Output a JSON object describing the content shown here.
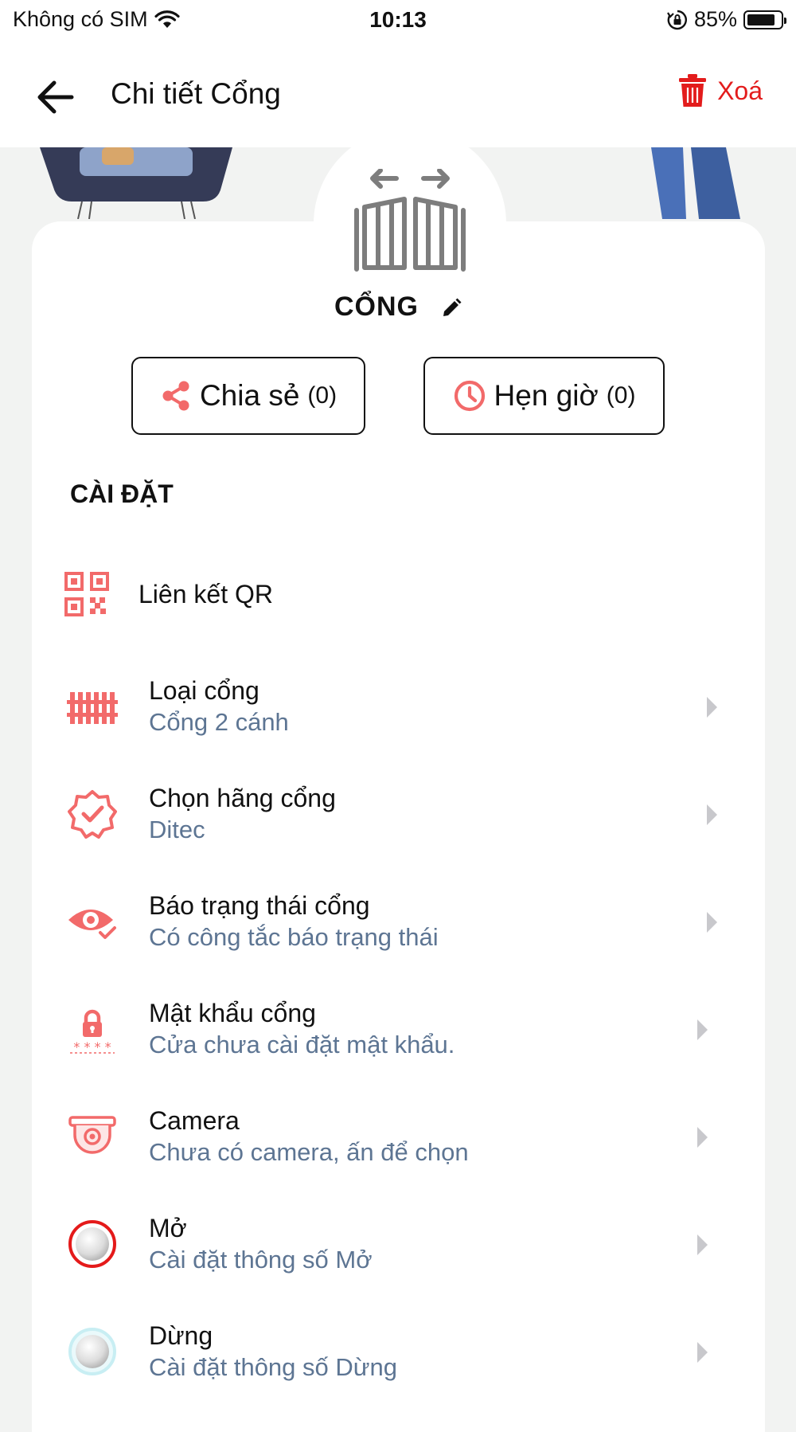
{
  "status_bar": {
    "carrier": "Không có SIM",
    "time": "10:13",
    "battery_percent": "85%",
    "battery_level": 0.85
  },
  "nav": {
    "title": "Chi tiết Cổng",
    "delete_label": "Xoá"
  },
  "device": {
    "name": "CỔNG"
  },
  "actions": {
    "share": {
      "label": "Chia sẻ",
      "count": "(0)"
    },
    "timer": {
      "label": "Hẹn giờ",
      "count": "(0)"
    }
  },
  "settings": {
    "section_title": "CÀI ĐẶT",
    "qr_label": "Liên kết QR",
    "items": [
      {
        "title": "Loại cổng",
        "subtitle": "Cổng 2 cánh",
        "icon": "fence-icon"
      },
      {
        "title": "Chọn hãng cổng",
        "subtitle": "Ditec",
        "icon": "verified-badge-icon"
      },
      {
        "title": "Báo trạng thái cổng",
        "subtitle": "Có công tắc báo trạng thái",
        "icon": "eye-check-icon"
      },
      {
        "title": "Mật khẩu cổng",
        "subtitle": "Cửa chưa cài đặt mật khẩu.",
        "icon": "lock-password-icon"
      },
      {
        "title": "Camera",
        "subtitle": "Chưa có camera, ấn để chọn",
        "icon": "camera-icon"
      },
      {
        "title": "Mở",
        "subtitle": "Cài đặt thông số Mở",
        "icon": "open-button-icon"
      },
      {
        "title": "Dừng",
        "subtitle": "Cài đặt thông số Dừng",
        "icon": "stop-button-icon"
      }
    ]
  },
  "colors": {
    "accent": "#f26a6a",
    "danger": "#e31c1c",
    "subtitle": "#5d7593",
    "background": "#f2f3f2"
  }
}
